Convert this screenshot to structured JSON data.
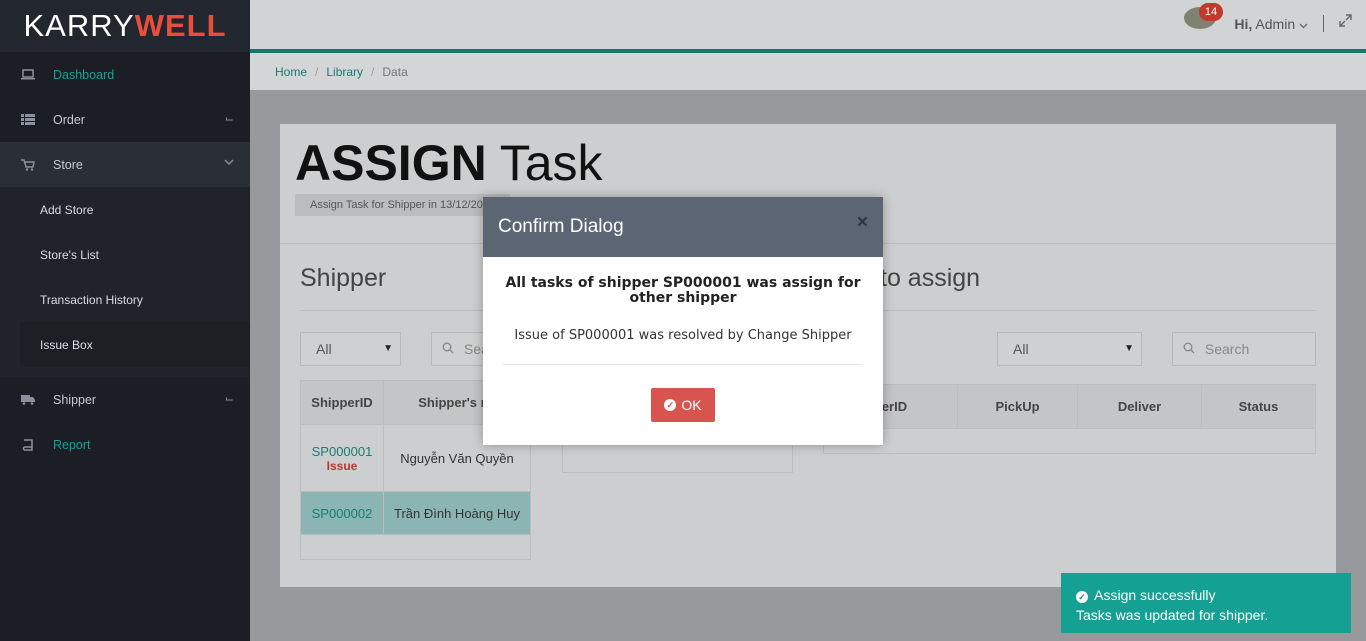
{
  "logo": {
    "part1": "KARRY",
    "part2": "WELL"
  },
  "sidebar": {
    "items": [
      {
        "label": "Dashboard"
      },
      {
        "label": "Order"
      },
      {
        "label": "Store"
      },
      {
        "label": "Shipper"
      },
      {
        "label": "Report"
      }
    ],
    "store_sub": [
      {
        "label": "Add Store"
      },
      {
        "label": "Store's List"
      },
      {
        "label": "Transaction History"
      },
      {
        "label": "Issue Box"
      }
    ]
  },
  "topbar": {
    "notif_count": "14",
    "greeting": "Hi,",
    "user": "Admin"
  },
  "breadcrumb": {
    "home": "Home",
    "library": "Library",
    "current": "Data"
  },
  "page": {
    "title_bold": "ASSIGN",
    "title_rest": "Task",
    "subtitle": "Assign Task for Shipper in 13/12/20"
  },
  "shipper": {
    "section_title": "Shipper",
    "filter": "All",
    "search_placeholder": "Sea",
    "columns": [
      "ShipperID",
      "Shipper's na"
    ],
    "rows": [
      {
        "id": "SP000001",
        "issue": "Issue",
        "name": "Nguyễn Văn Quyền"
      },
      {
        "id": "SP000002",
        "issue": "",
        "name": "Trần Đình Hoàng Huy"
      }
    ]
  },
  "tasks": {
    "section_title": "to assign",
    "filter": "All",
    "search_placeholder": "Search",
    "columns": [
      "derID",
      "PickUp",
      "Deliver",
      "Status"
    ]
  },
  "modal": {
    "title": "Confirm Dialog",
    "close": "×",
    "heading": "All tasks of shipper SP000001 was assign for other shipper",
    "message": "Issue of SP000001 was resolved by Change Shipper",
    "ok_label": "OK"
  },
  "toast": {
    "title": "Assign successfully",
    "message": "Tasks was updated for shipper."
  },
  "colors": {
    "accent": "#17a398",
    "brand_red": "#e94e3c",
    "danger": "#d9534f",
    "toast": "#14a092"
  }
}
